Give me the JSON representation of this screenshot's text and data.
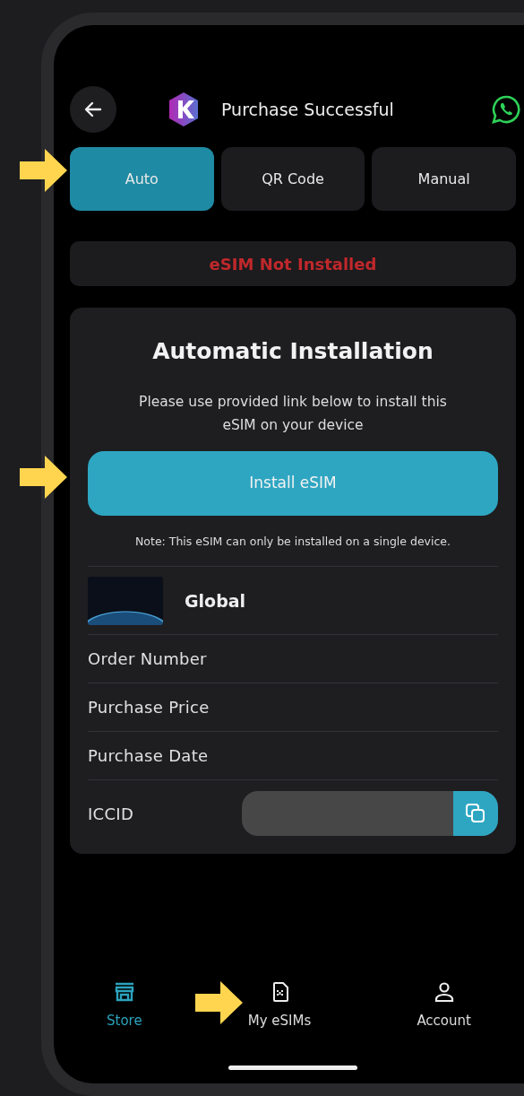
{
  "header": {
    "title": "Purchase Successful"
  },
  "tabs": [
    {
      "label": "Auto",
      "selected": true
    },
    {
      "label": "QR Code",
      "selected": false
    },
    {
      "label": "Manual",
      "selected": false
    }
  ],
  "status": {
    "text": "eSIM Not Installed",
    "installed": false
  },
  "card": {
    "title": "Automatic Installation",
    "description": "Please use provided link below to install this eSIM on your device",
    "install_button": "Install eSIM",
    "note": "Note: This eSIM can only be installed on a single device.",
    "plan": {
      "name": "Global"
    },
    "rows": [
      {
        "kind": "text",
        "label": "Order Number"
      },
      {
        "kind": "text",
        "label": "Purchase Price"
      },
      {
        "kind": "text",
        "label": "Purchase Date"
      },
      {
        "kind": "copy",
        "label": "ICCID"
      }
    ]
  },
  "nav": [
    {
      "label": "Store",
      "selected": true
    },
    {
      "label": "My eSIMs",
      "selected": false
    },
    {
      "label": "Account",
      "selected": false
    }
  ]
}
